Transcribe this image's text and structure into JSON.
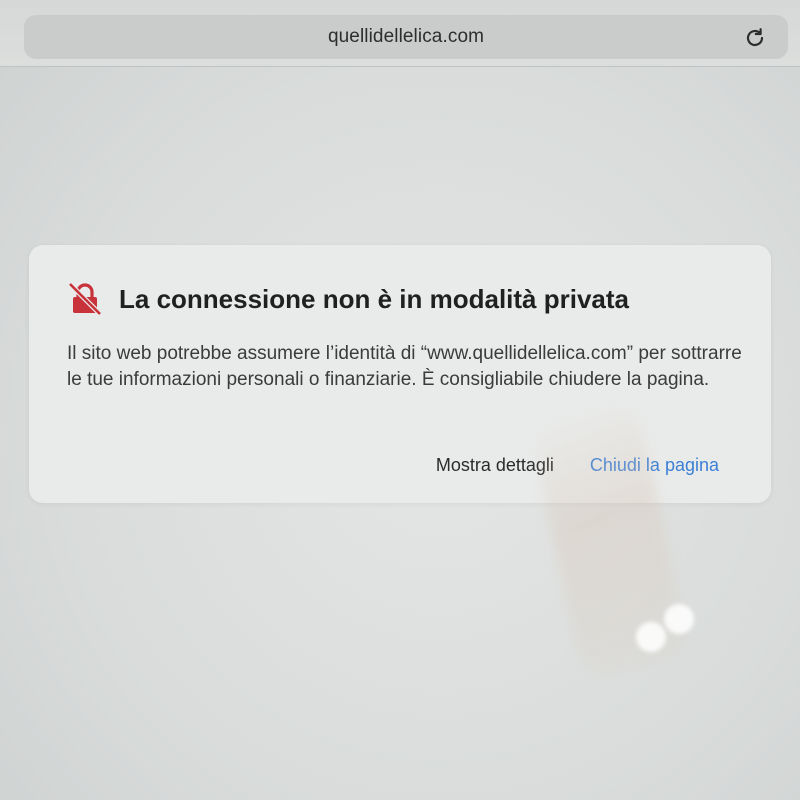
{
  "browser": {
    "address": "quellidellelica.com",
    "reload_icon": "reload-icon"
  },
  "warning": {
    "icon": "insecure-lock-icon",
    "title": "La connessione non è in modalità privata",
    "body": "Il sito web potrebbe assumere l’identità di “www.quellidellelica.com” per sottrarre le tue informazioni personali o finanziarie. È consigliabile chiudere la pagina.",
    "details_label": "Mostra dettagli",
    "close_label": "Chiudi la pagina"
  },
  "colors": {
    "warning_icon": "#c8323a",
    "link": "#3b7fd6",
    "card_background": "#e9ebea"
  }
}
